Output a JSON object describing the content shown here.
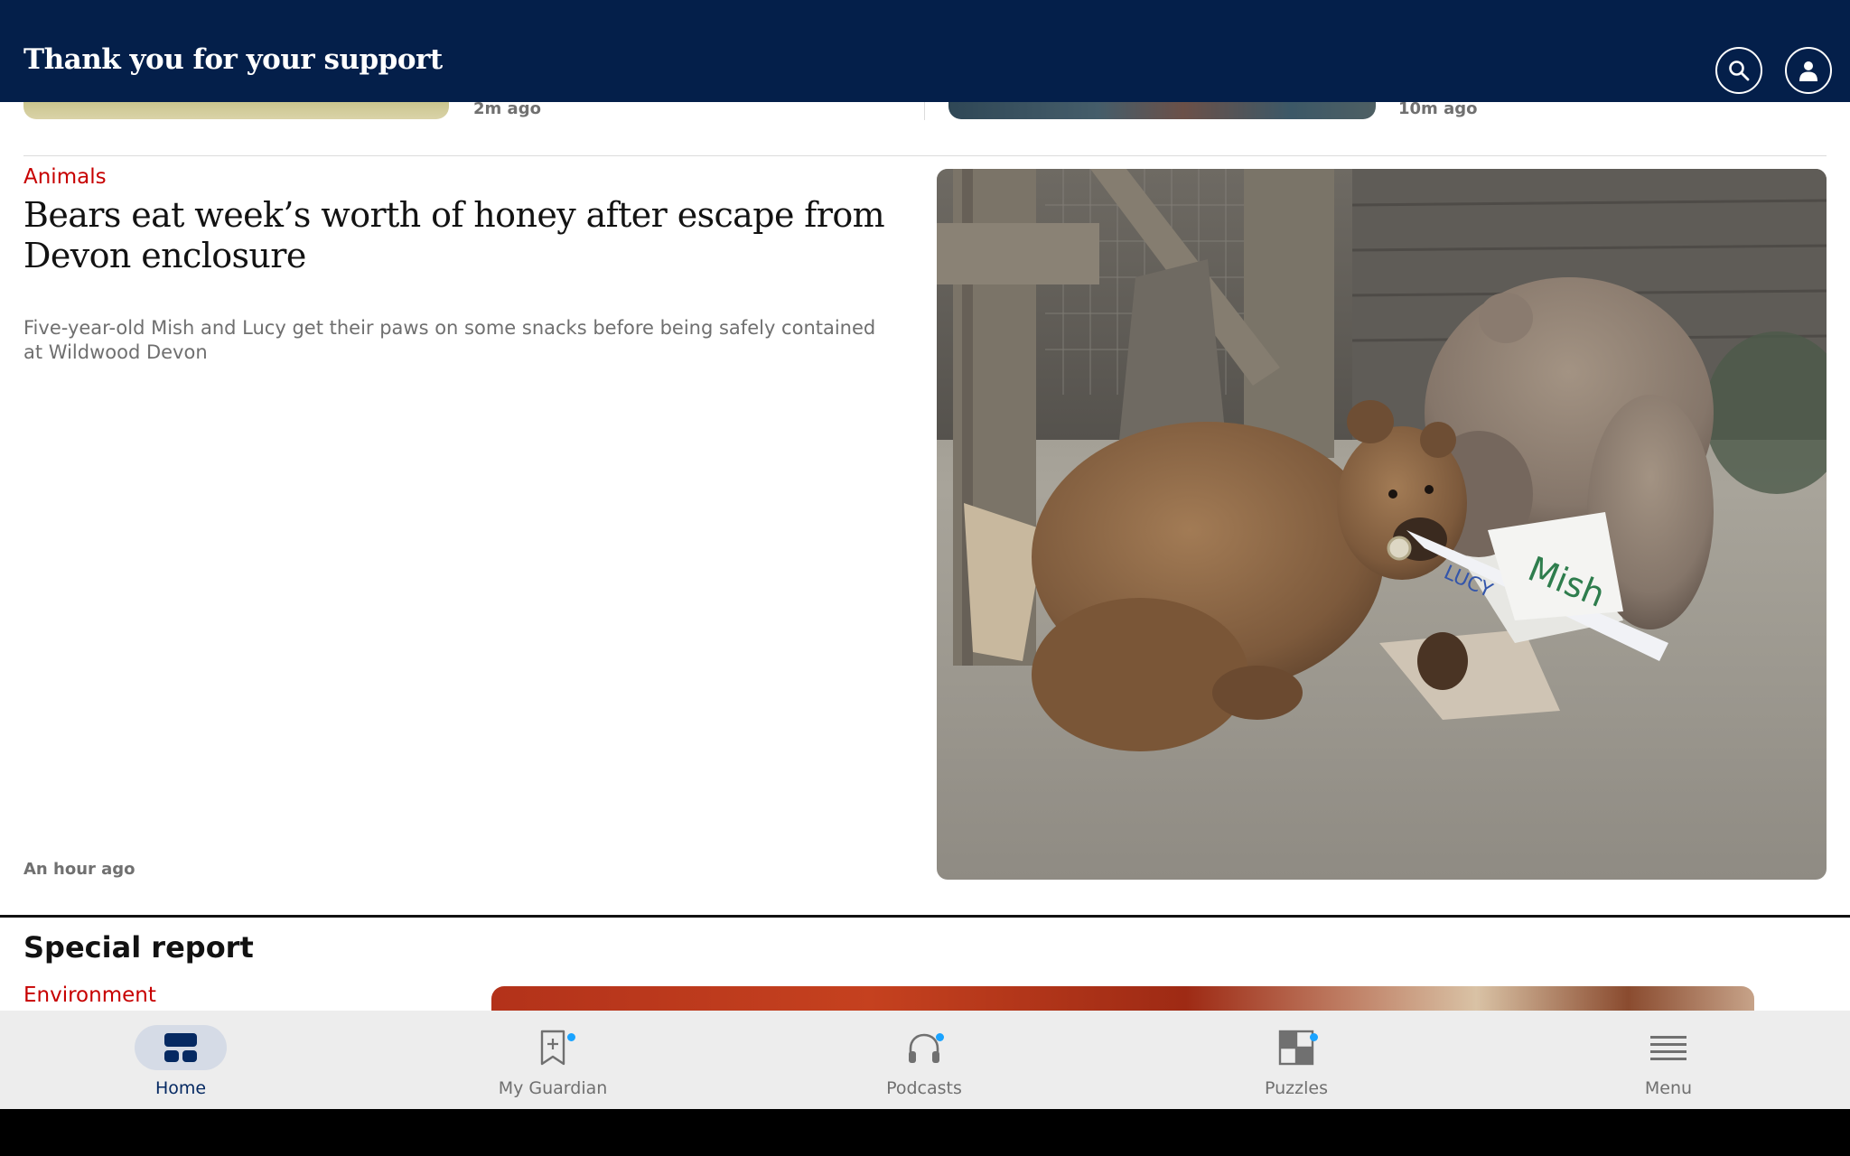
{
  "header": {
    "title": "Thank you for your support",
    "search_icon": "search-icon",
    "profile_icon": "profile-icon"
  },
  "previous_row": [
    {
      "time": "2m ago"
    },
    {
      "time": "10m ago"
    }
  ],
  "article": {
    "kicker": "Animals",
    "headline": "Bears eat week’s worth of honey after escape from Devon enclosure",
    "standfirst": "Five-year-old Mish and Lucy get their paws on some snacks before being safely contained at Wildwood Devon",
    "age": "An hour ago",
    "image_text": {
      "lucy": "LUCY",
      "mish": "Mish"
    }
  },
  "special_report": {
    "title": "Special report",
    "kicker": "Environment"
  },
  "bottom_nav": [
    {
      "label": "Home",
      "icon": "home-icon",
      "active": true,
      "dot": false
    },
    {
      "label": "My Guardian",
      "icon": "bookmark-icon",
      "active": false,
      "dot": true
    },
    {
      "label": "Podcasts",
      "icon": "headphones-icon",
      "active": false,
      "dot": true
    },
    {
      "label": "Puzzles",
      "icon": "puzzle-grid-icon",
      "active": false,
      "dot": true
    },
    {
      "label": "Menu",
      "icon": "menu-icon",
      "active": false,
      "dot": false
    }
  ],
  "colors": {
    "header_bg": "#041f4a",
    "kicker_red": "#c70000",
    "nav_active": "#052962",
    "notification_dot": "#1aa3ff"
  }
}
